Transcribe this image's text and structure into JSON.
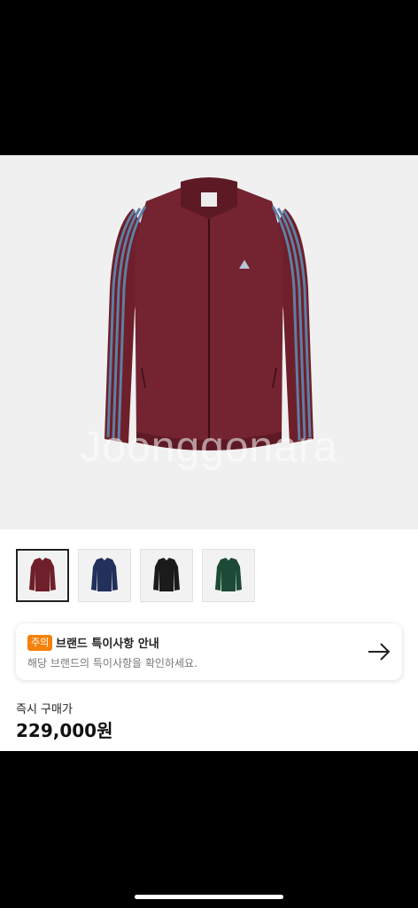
{
  "product": {
    "watermark": "Joonggonara",
    "hero_image": "maroon-track-jacket-photo",
    "thumbnails": [
      {
        "color": "#6e1f2a",
        "label": "maroon-jacket-thumbnail",
        "selected": true
      },
      {
        "color": "#22305c",
        "label": "navy-jacket-thumbnail",
        "selected": false
      },
      {
        "color": "#1b1b1b",
        "label": "black-jacket-thumbnail",
        "selected": false
      },
      {
        "color": "#1d4a36",
        "label": "green-jacket-thumbnail",
        "selected": false
      }
    ]
  },
  "notice": {
    "badge": "주의",
    "title": "브랜드 특이사항 안내",
    "subtitle": "해당 브랜드의 특이사항을 확인하세요.",
    "icon": "arrow-right-icon"
  },
  "purchase": {
    "label": "즉시 구매가",
    "price": "229,000원"
  },
  "colors": {
    "badge": "#f5820b",
    "jacket": "#6e1f2a",
    "stripe": "#5f7fa3"
  }
}
